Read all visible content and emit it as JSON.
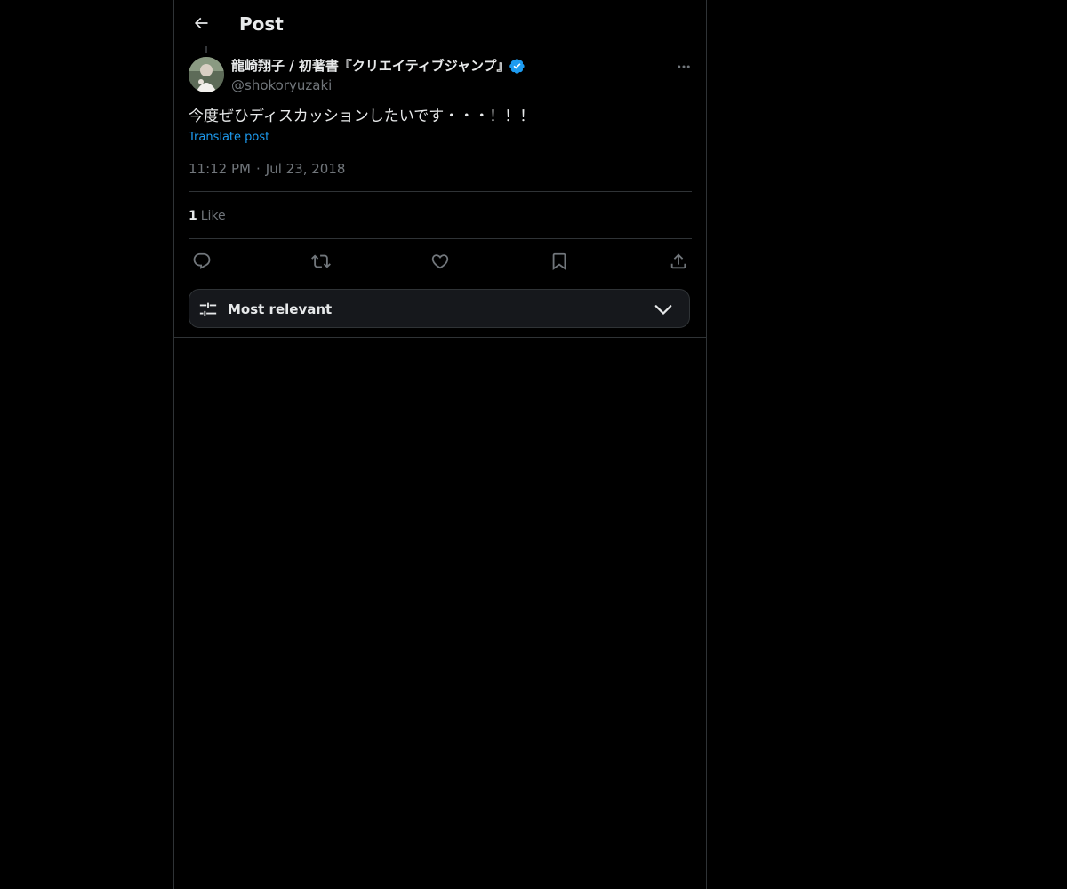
{
  "header": {
    "title": "Post",
    "back_icon": "arrow-left-icon"
  },
  "post": {
    "author_name": "龍崎翔子 / 初著書『クリエイティブジャンプ』",
    "author_handle": "@shokoryuzaki",
    "verified_color": "#1d9bf0",
    "text": "今度ぜひディスカッションしたいです・・・！！！",
    "translate_label": "Translate post",
    "time": "11:12 PM",
    "date": "Jul 23, 2018",
    "likes_count": "1",
    "likes_label": "Like"
  },
  "actions": [
    "reply-icon",
    "repost-icon",
    "like-icon",
    "bookmark-icon",
    "share-icon"
  ],
  "sort": {
    "label": "Most relevant"
  },
  "colors": {
    "background": "#000000",
    "text": "#e7e9ea",
    "muted": "#71767b",
    "accent": "#1d9bf0",
    "border": "#2f3336"
  }
}
